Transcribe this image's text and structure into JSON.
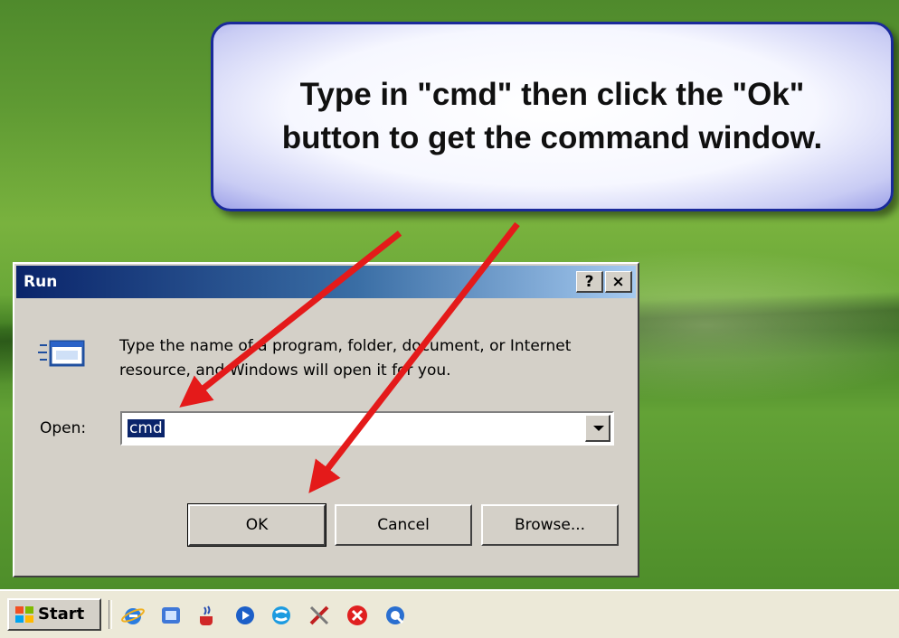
{
  "callout": {
    "text": "Type in \"cmd\" then click the \"Ok\" button to get the command window."
  },
  "dialog": {
    "title": "Run",
    "help_label": "?",
    "close_label": "×",
    "description": "Type the name of a program, folder, document, or Internet resource, and Windows will open it for you.",
    "open_label": "Open:",
    "open_value": "cmd",
    "buttons": {
      "ok": "OK",
      "cancel": "Cancel",
      "browse": "Browse..."
    }
  },
  "taskbar": {
    "start_label": "Start",
    "quick_launch_icons": [
      "internet-explorer-icon",
      "show-desktop-icon",
      "java-icon",
      "media-player-icon",
      "messenger-icon",
      "tools-icon",
      "stop-icon",
      "quicktime-icon"
    ]
  },
  "colors": {
    "arrow": "#e41a1a",
    "callout_border": "#1a2a9a",
    "titlebar": "#0a246a",
    "dialog_face": "#d4d0c8"
  }
}
